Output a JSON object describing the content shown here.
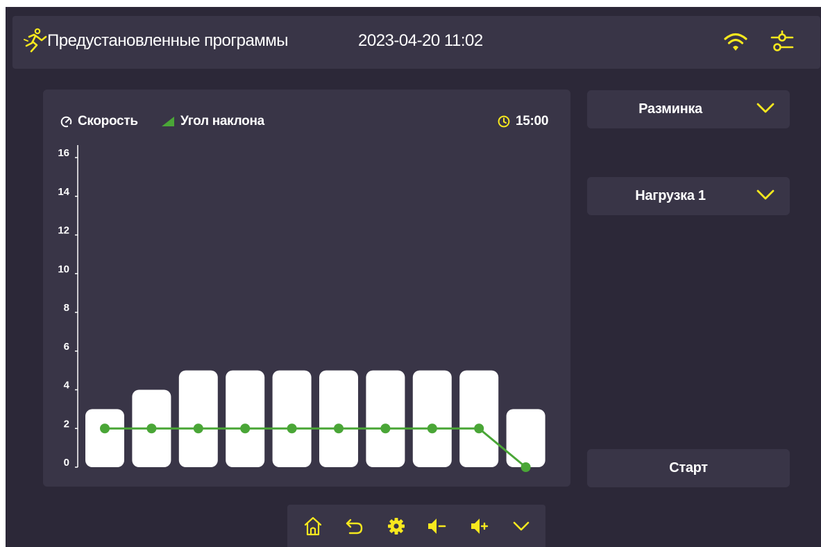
{
  "header": {
    "title": "Предустановленные программы",
    "datetime": "2023-04-20 11:02",
    "icons": [
      "runner-icon",
      "wifi-icon",
      "settings-sliders-icon"
    ]
  },
  "legend": {
    "speed_label": "Скорость",
    "incline_label": "Угол наклона",
    "duration": "15:00"
  },
  "program_select": {
    "value": "Разминка"
  },
  "load_select": {
    "value": "Нагрузка 1"
  },
  "start_label": "Старт",
  "bottom_nav": [
    "home-icon",
    "back-icon",
    "gear-icon",
    "volume-down-icon",
    "volume-up-icon",
    "chevron-down-icon"
  ],
  "colors": {
    "accent": "#f7e81e",
    "background": "#2c2838",
    "panel": "#393547",
    "incline_line": "#4aa637",
    "bar": "#ffffff"
  },
  "chart_data": {
    "type": "bar",
    "yticks": [
      0,
      2,
      4,
      6,
      8,
      10,
      12,
      14,
      16
    ],
    "ylim": [
      0,
      16
    ],
    "series": [
      {
        "name": "Скорость",
        "values": [
          3,
          4,
          5,
          5,
          5,
          5,
          5,
          5,
          5,
          3
        ]
      },
      {
        "name": "Угол наклона",
        "values": [
          2,
          2,
          2,
          2,
          2,
          2,
          2,
          2,
          2,
          0
        ]
      }
    ]
  }
}
